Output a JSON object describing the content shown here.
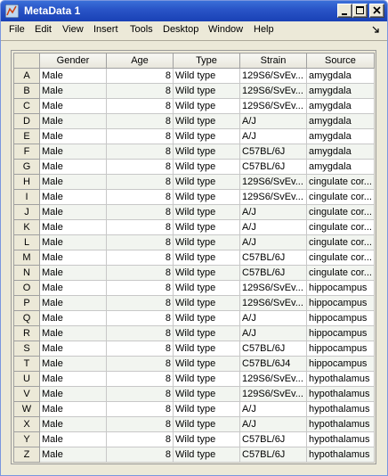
{
  "window": {
    "title": "MetaData 1"
  },
  "menu": [
    "File",
    "Edit",
    "View",
    "Insert",
    "Tools",
    "Desktop",
    "Window",
    "Help"
  ],
  "table": {
    "columns": [
      "Gender",
      "Age",
      "Type",
      "Strain",
      "Source"
    ],
    "rows": [
      {
        "id": "A",
        "gender": "Male",
        "age": "8",
        "type": "Wild type",
        "strain": "129S6/SvEv...",
        "source": "amygdala"
      },
      {
        "id": "B",
        "gender": "Male",
        "age": "8",
        "type": "Wild type",
        "strain": "129S6/SvEv...",
        "source": "amygdala"
      },
      {
        "id": "C",
        "gender": "Male",
        "age": "8",
        "type": "Wild type",
        "strain": "129S6/SvEv...",
        "source": "amygdala"
      },
      {
        "id": "D",
        "gender": "Male",
        "age": "8",
        "type": "Wild type",
        "strain": "A/J",
        "source": "amygdala"
      },
      {
        "id": "E",
        "gender": "Male",
        "age": "8",
        "type": "Wild type",
        "strain": "A/J",
        "source": "amygdala"
      },
      {
        "id": "F",
        "gender": "Male",
        "age": "8",
        "type": "Wild type",
        "strain": "C57BL/6J",
        "source": "amygdala"
      },
      {
        "id": "G",
        "gender": "Male",
        "age": "8",
        "type": "Wild type",
        "strain": "C57BL/6J",
        "source": "amygdala"
      },
      {
        "id": "H",
        "gender": "Male",
        "age": "8",
        "type": "Wild type",
        "strain": "129S6/SvEv...",
        "source": "cingulate cor..."
      },
      {
        "id": "I",
        "gender": "Male",
        "age": "8",
        "type": "Wild type",
        "strain": "129S6/SvEv...",
        "source": "cingulate cor..."
      },
      {
        "id": "J",
        "gender": "Male",
        "age": "8",
        "type": "Wild type",
        "strain": "A/J",
        "source": "cingulate cor..."
      },
      {
        "id": "K",
        "gender": "Male",
        "age": "8",
        "type": "Wild type",
        "strain": "A/J",
        "source": "cingulate cor..."
      },
      {
        "id": "L",
        "gender": "Male",
        "age": "8",
        "type": "Wild type",
        "strain": "A/J",
        "source": "cingulate cor..."
      },
      {
        "id": "M",
        "gender": "Male",
        "age": "8",
        "type": "Wild type",
        "strain": "C57BL/6J",
        "source": "cingulate cor..."
      },
      {
        "id": "N",
        "gender": "Male",
        "age": "8",
        "type": "Wild type",
        "strain": "C57BL/6J",
        "source": "cingulate cor..."
      },
      {
        "id": "O",
        "gender": "Male",
        "age": "8",
        "type": "Wild type",
        "strain": "129S6/SvEv...",
        "source": "hippocampus"
      },
      {
        "id": "P",
        "gender": "Male",
        "age": "8",
        "type": "Wild type",
        "strain": "129S6/SvEv...",
        "source": "hippocampus"
      },
      {
        "id": "Q",
        "gender": "Male",
        "age": "8",
        "type": "Wild type",
        "strain": "A/J",
        "source": "hippocampus"
      },
      {
        "id": "R",
        "gender": "Male",
        "age": "8",
        "type": "Wild type",
        "strain": "A/J",
        "source": "hippocampus"
      },
      {
        "id": "S",
        "gender": "Male",
        "age": "8",
        "type": "Wild type",
        "strain": "C57BL/6J",
        "source": "hippocampus"
      },
      {
        "id": "T",
        "gender": "Male",
        "age": "8",
        "type": "Wild type",
        "strain": "C57BL/6J4",
        "source": "hippocampus"
      },
      {
        "id": "U",
        "gender": "Male",
        "age": "8",
        "type": "Wild type",
        "strain": "129S6/SvEv...",
        "source": "hypothalamus"
      },
      {
        "id": "V",
        "gender": "Male",
        "age": "8",
        "type": "Wild type",
        "strain": "129S6/SvEv...",
        "source": "hypothalamus"
      },
      {
        "id": "W",
        "gender": "Male",
        "age": "8",
        "type": "Wild type",
        "strain": "A/J",
        "source": "hypothalamus"
      },
      {
        "id": "X",
        "gender": "Male",
        "age": "8",
        "type": "Wild type",
        "strain": "A/J",
        "source": "hypothalamus"
      },
      {
        "id": "Y",
        "gender": "Male",
        "age": "8",
        "type": "Wild type",
        "strain": "C57BL/6J",
        "source": "hypothalamus"
      },
      {
        "id": "Z",
        "gender": "Male",
        "age": "8",
        "type": "Wild type",
        "strain": "C57BL/6J",
        "source": "hypothalamus"
      }
    ]
  }
}
